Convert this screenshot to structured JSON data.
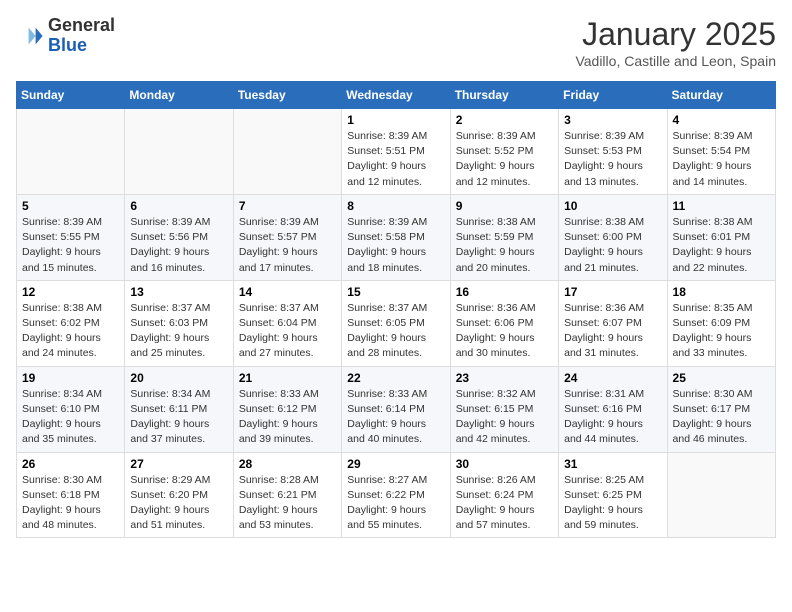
{
  "logo": {
    "general": "General",
    "blue": "Blue"
  },
  "header": {
    "title": "January 2025",
    "subtitle": "Vadillo, Castille and Leon, Spain"
  },
  "weekdays": [
    "Sunday",
    "Monday",
    "Tuesday",
    "Wednesday",
    "Thursday",
    "Friday",
    "Saturday"
  ],
  "weeks": [
    [
      {
        "day": "",
        "info": ""
      },
      {
        "day": "",
        "info": ""
      },
      {
        "day": "",
        "info": ""
      },
      {
        "day": "1",
        "info": "Sunrise: 8:39 AM\nSunset: 5:51 PM\nDaylight: 9 hours\nand 12 minutes."
      },
      {
        "day": "2",
        "info": "Sunrise: 8:39 AM\nSunset: 5:52 PM\nDaylight: 9 hours\nand 12 minutes."
      },
      {
        "day": "3",
        "info": "Sunrise: 8:39 AM\nSunset: 5:53 PM\nDaylight: 9 hours\nand 13 minutes."
      },
      {
        "day": "4",
        "info": "Sunrise: 8:39 AM\nSunset: 5:54 PM\nDaylight: 9 hours\nand 14 minutes."
      }
    ],
    [
      {
        "day": "5",
        "info": "Sunrise: 8:39 AM\nSunset: 5:55 PM\nDaylight: 9 hours\nand 15 minutes."
      },
      {
        "day": "6",
        "info": "Sunrise: 8:39 AM\nSunset: 5:56 PM\nDaylight: 9 hours\nand 16 minutes."
      },
      {
        "day": "7",
        "info": "Sunrise: 8:39 AM\nSunset: 5:57 PM\nDaylight: 9 hours\nand 17 minutes."
      },
      {
        "day": "8",
        "info": "Sunrise: 8:39 AM\nSunset: 5:58 PM\nDaylight: 9 hours\nand 18 minutes."
      },
      {
        "day": "9",
        "info": "Sunrise: 8:38 AM\nSunset: 5:59 PM\nDaylight: 9 hours\nand 20 minutes."
      },
      {
        "day": "10",
        "info": "Sunrise: 8:38 AM\nSunset: 6:00 PM\nDaylight: 9 hours\nand 21 minutes."
      },
      {
        "day": "11",
        "info": "Sunrise: 8:38 AM\nSunset: 6:01 PM\nDaylight: 9 hours\nand 22 minutes."
      }
    ],
    [
      {
        "day": "12",
        "info": "Sunrise: 8:38 AM\nSunset: 6:02 PM\nDaylight: 9 hours\nand 24 minutes."
      },
      {
        "day": "13",
        "info": "Sunrise: 8:37 AM\nSunset: 6:03 PM\nDaylight: 9 hours\nand 25 minutes."
      },
      {
        "day": "14",
        "info": "Sunrise: 8:37 AM\nSunset: 6:04 PM\nDaylight: 9 hours\nand 27 minutes."
      },
      {
        "day": "15",
        "info": "Sunrise: 8:37 AM\nSunset: 6:05 PM\nDaylight: 9 hours\nand 28 minutes."
      },
      {
        "day": "16",
        "info": "Sunrise: 8:36 AM\nSunset: 6:06 PM\nDaylight: 9 hours\nand 30 minutes."
      },
      {
        "day": "17",
        "info": "Sunrise: 8:36 AM\nSunset: 6:07 PM\nDaylight: 9 hours\nand 31 minutes."
      },
      {
        "day": "18",
        "info": "Sunrise: 8:35 AM\nSunset: 6:09 PM\nDaylight: 9 hours\nand 33 minutes."
      }
    ],
    [
      {
        "day": "19",
        "info": "Sunrise: 8:34 AM\nSunset: 6:10 PM\nDaylight: 9 hours\nand 35 minutes."
      },
      {
        "day": "20",
        "info": "Sunrise: 8:34 AM\nSunset: 6:11 PM\nDaylight: 9 hours\nand 37 minutes."
      },
      {
        "day": "21",
        "info": "Sunrise: 8:33 AM\nSunset: 6:12 PM\nDaylight: 9 hours\nand 39 minutes."
      },
      {
        "day": "22",
        "info": "Sunrise: 8:33 AM\nSunset: 6:14 PM\nDaylight: 9 hours\nand 40 minutes."
      },
      {
        "day": "23",
        "info": "Sunrise: 8:32 AM\nSunset: 6:15 PM\nDaylight: 9 hours\nand 42 minutes."
      },
      {
        "day": "24",
        "info": "Sunrise: 8:31 AM\nSunset: 6:16 PM\nDaylight: 9 hours\nand 44 minutes."
      },
      {
        "day": "25",
        "info": "Sunrise: 8:30 AM\nSunset: 6:17 PM\nDaylight: 9 hours\nand 46 minutes."
      }
    ],
    [
      {
        "day": "26",
        "info": "Sunrise: 8:30 AM\nSunset: 6:18 PM\nDaylight: 9 hours\nand 48 minutes."
      },
      {
        "day": "27",
        "info": "Sunrise: 8:29 AM\nSunset: 6:20 PM\nDaylight: 9 hours\nand 51 minutes."
      },
      {
        "day": "28",
        "info": "Sunrise: 8:28 AM\nSunset: 6:21 PM\nDaylight: 9 hours\nand 53 minutes."
      },
      {
        "day": "29",
        "info": "Sunrise: 8:27 AM\nSunset: 6:22 PM\nDaylight: 9 hours\nand 55 minutes."
      },
      {
        "day": "30",
        "info": "Sunrise: 8:26 AM\nSunset: 6:24 PM\nDaylight: 9 hours\nand 57 minutes."
      },
      {
        "day": "31",
        "info": "Sunrise: 8:25 AM\nSunset: 6:25 PM\nDaylight: 9 hours\nand 59 minutes."
      },
      {
        "day": "",
        "info": ""
      }
    ]
  ]
}
